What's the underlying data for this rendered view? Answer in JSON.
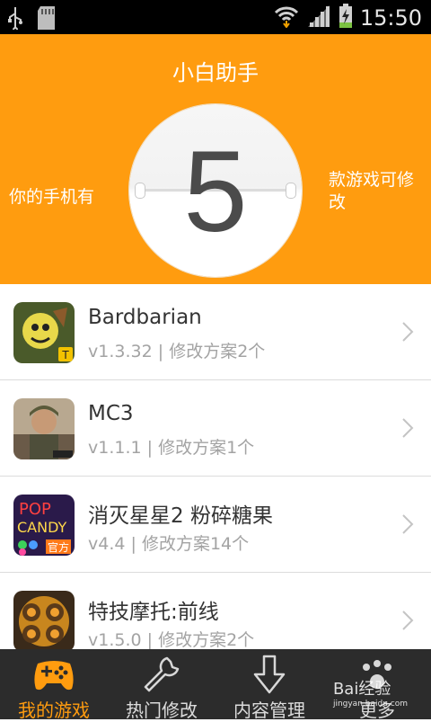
{
  "status_bar": {
    "time": "15:50",
    "icons": [
      "usb-icon",
      "sd-card-icon",
      "wifi-icon",
      "signal-icon",
      "battery-charging-icon"
    ]
  },
  "header": {
    "title": "小白助手",
    "count": "5",
    "left_text": "你的手机有",
    "right_text": "款游戏可修改"
  },
  "games": [
    {
      "name": "Bardbarian",
      "version": "v1.3.32",
      "separator": "|",
      "plans": "修改方案2个"
    },
    {
      "name": "MC3",
      "version": "v1.1.1",
      "separator": "|",
      "plans": "修改方案1个"
    },
    {
      "name": "消灭星星2 粉碎糖果",
      "version": "v4.4",
      "separator": "|",
      "plans": "修改方案14个"
    },
    {
      "name": "特技摩托:前线",
      "version": "v1.5.0",
      "separator": "|",
      "plans": "修改方案2个"
    }
  ],
  "nav": [
    {
      "label": "我的游戏",
      "icon": "gamepad-icon",
      "active": true
    },
    {
      "label": "热门修改",
      "icon": "wrench-icon",
      "active": false
    },
    {
      "label": "内容管理",
      "icon": "download-arrow-icon",
      "active": false
    },
    {
      "label": "更多",
      "icon": "more-icon",
      "active": false
    }
  ],
  "watermark": {
    "brand": "Bai经验",
    "url": "jingyan.baidu.com"
  },
  "colors": {
    "accent": "#ff9c0f",
    "nav_bg": "#2c2c2c",
    "status_bg": "#000000"
  }
}
